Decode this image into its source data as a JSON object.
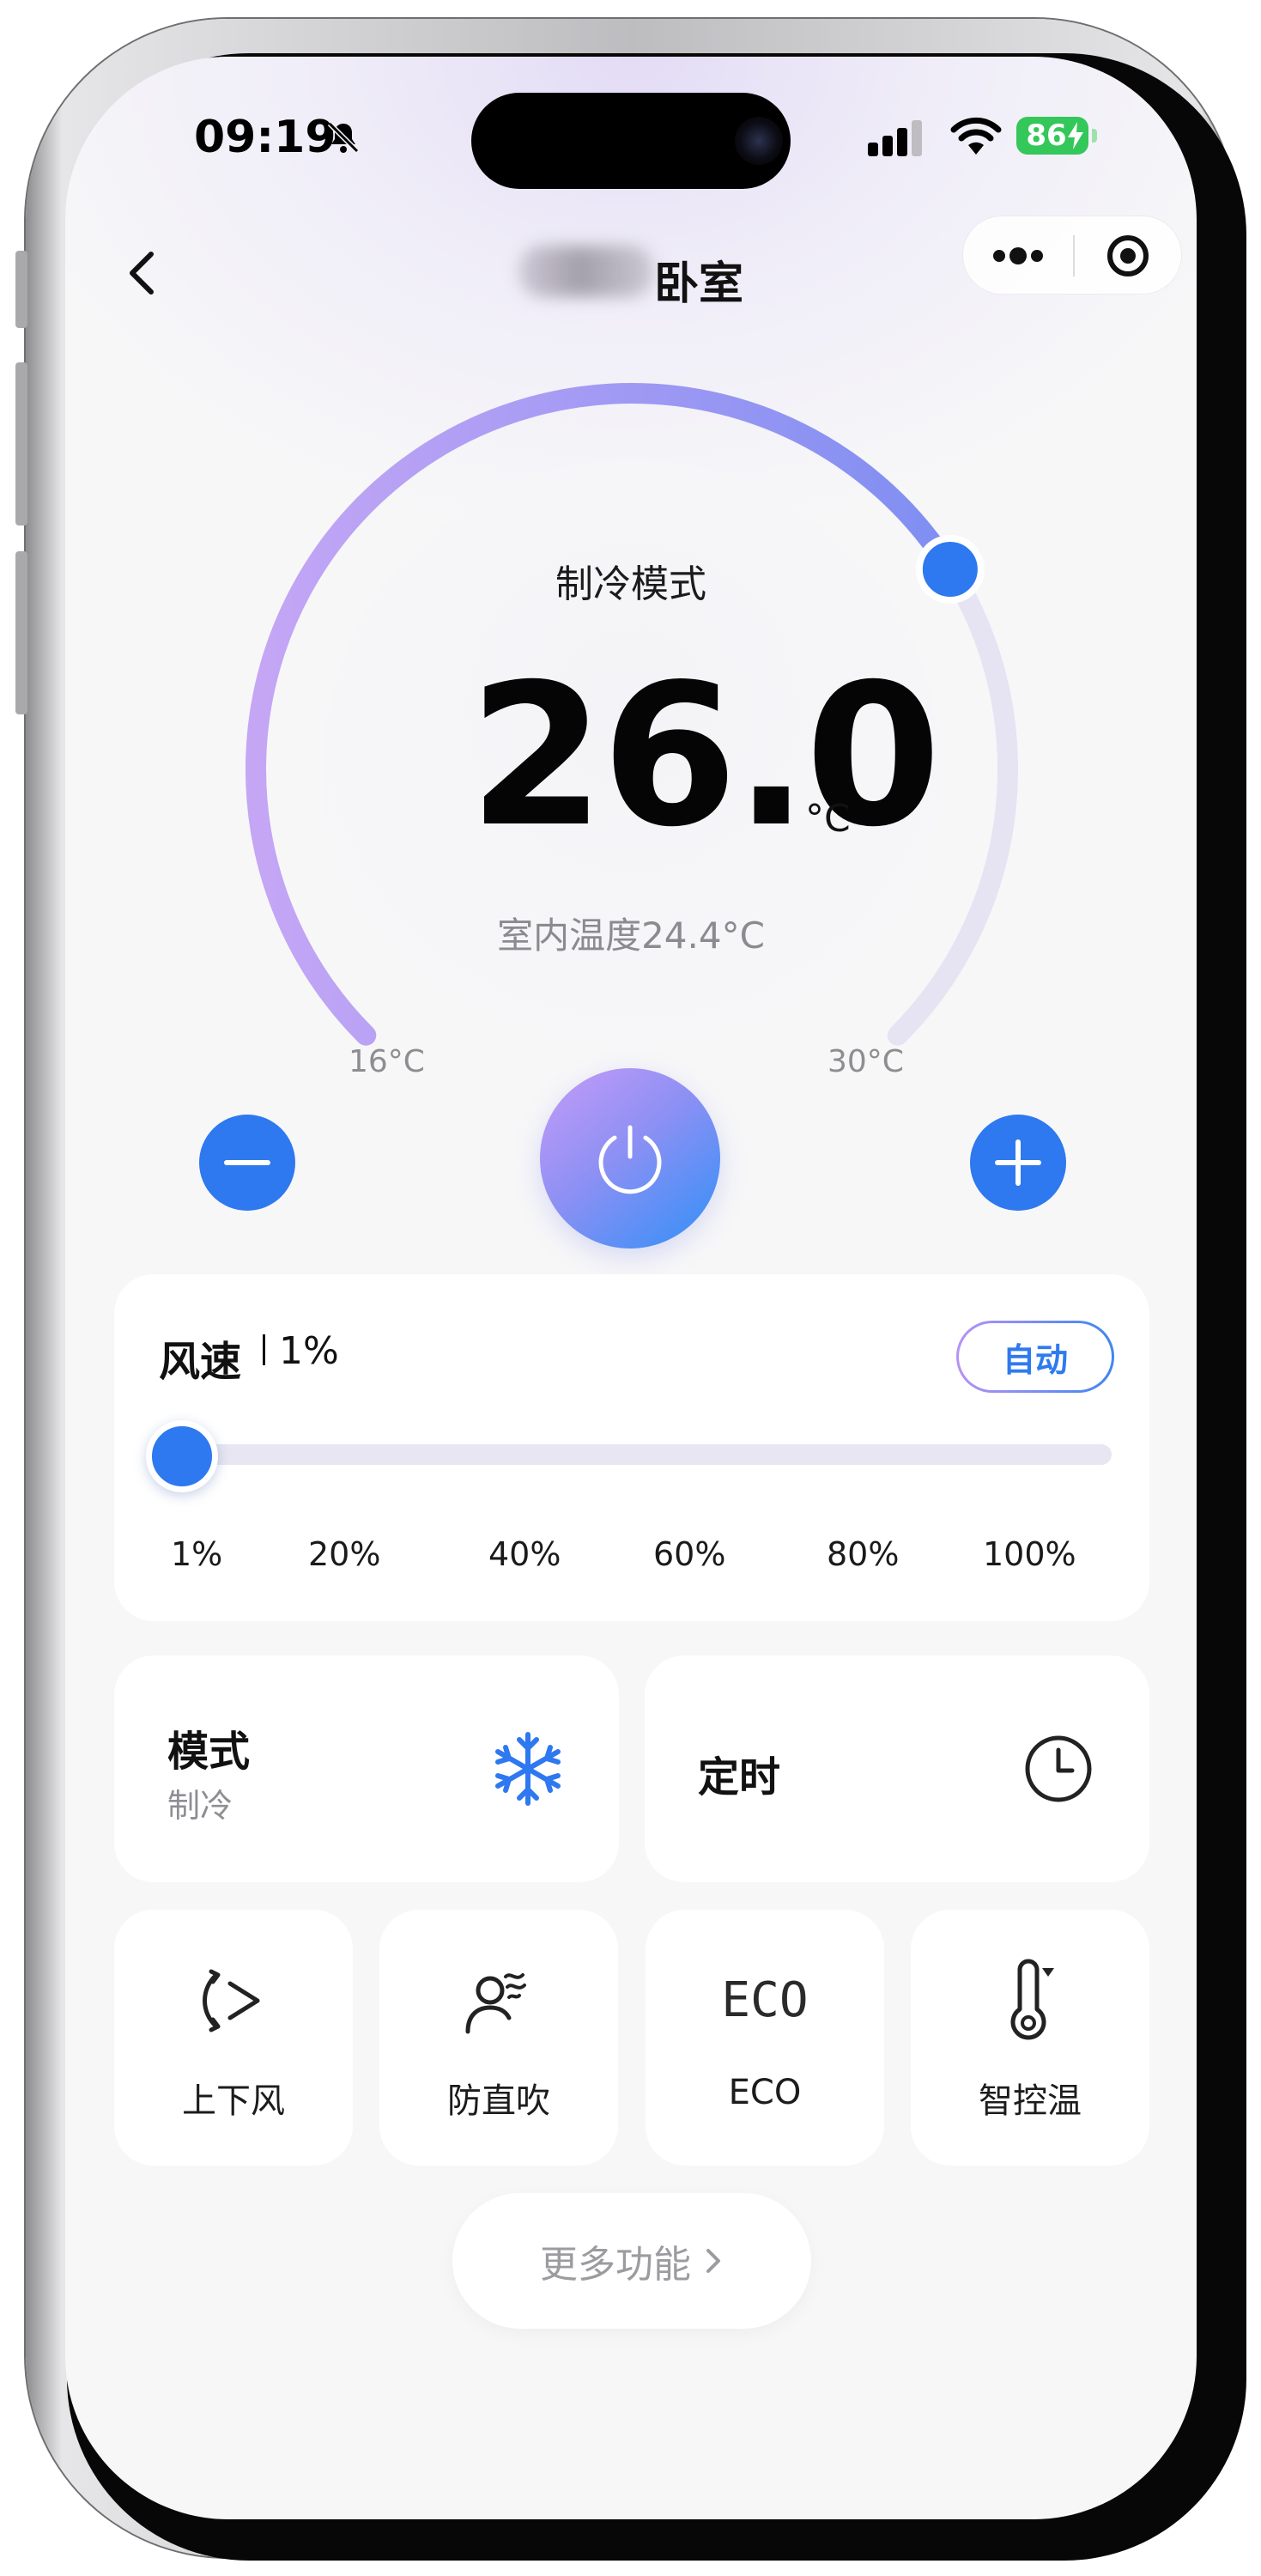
{
  "status_bar": {
    "time": "09:19",
    "battery": "86",
    "icons": [
      "bell-muted-icon",
      "cellular-signal-icon",
      "wifi-icon",
      "battery-charging-icon"
    ]
  },
  "nav": {
    "title": "卧室",
    "title_prefix_obscured": true,
    "back_icon": "chevron-left-icon",
    "capsule_icons": [
      "more-dots-icon",
      "target-icon"
    ]
  },
  "thermostat": {
    "mode_label": "制冷模式",
    "set_temperature": "26.0",
    "unit": "°C",
    "indoor_label": "室内温度24.4°C",
    "min_label": "16°C",
    "max_label": "30°C",
    "range": [
      16,
      30
    ],
    "value": 26.0,
    "accent_colors": {
      "arc_start": "#c5a6f5",
      "arc_end": "#7f8ef2",
      "knob": "#2e78f0",
      "track": "#e6e4f3"
    }
  },
  "controls": {
    "minus_icon": "minus-icon",
    "power_icon": "power-icon",
    "plus_icon": "plus-icon"
  },
  "wind": {
    "title": "风速",
    "value_label": "1%",
    "value": 1,
    "auto_label": "自动",
    "ticks": [
      "1%",
      "20%",
      "40%",
      "60%",
      "80%",
      "100%"
    ]
  },
  "mode_card": {
    "title": "模式",
    "subtitle": "制冷",
    "icon": "snowflake-icon"
  },
  "timer_card": {
    "title": "定时",
    "icon": "clock-icon"
  },
  "features": [
    {
      "label": "上下风",
      "icon": "swing-vertical-icon"
    },
    {
      "label": "防直吹",
      "icon": "anti-direct-blow-icon"
    },
    {
      "label": "ECO",
      "icon": "eco-icon",
      "glyph": "ECO"
    },
    {
      "label": "智控温",
      "icon": "smart-thermometer-icon"
    }
  ],
  "more_features": {
    "label": "更多功能",
    "icon": "chevron-right-icon"
  }
}
